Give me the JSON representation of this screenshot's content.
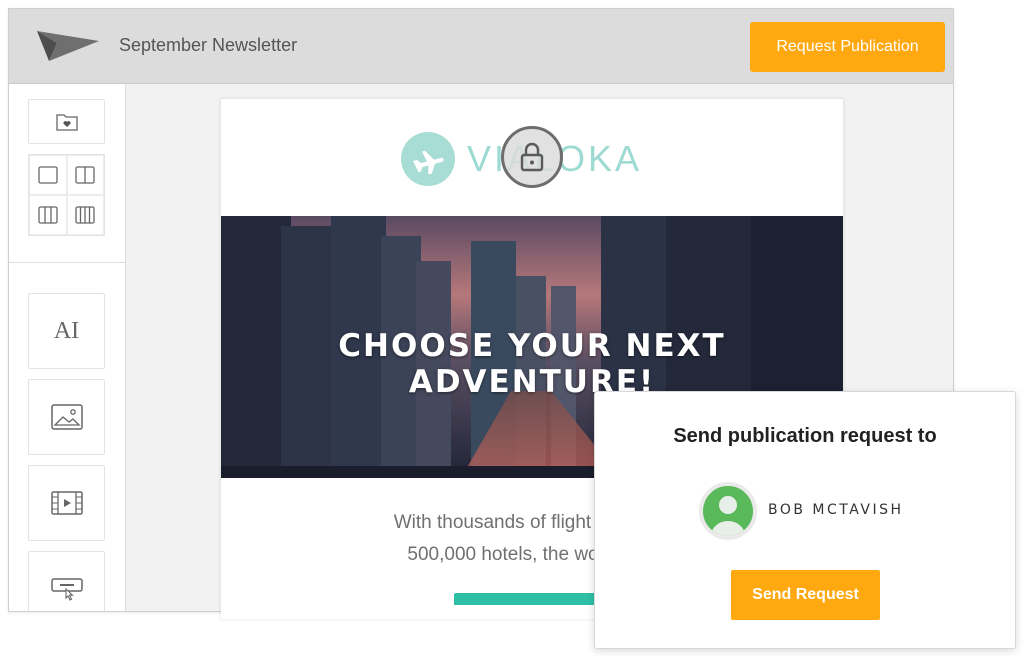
{
  "header": {
    "logo_icon": "paper-plane-logo-icon",
    "title": "September Newsletter",
    "publish_button": "Request Publication"
  },
  "sidebar": {
    "folder_icon": "favorites-folder-icon",
    "layouts": [
      "one-column-layout-icon",
      "two-column-layout-icon",
      "three-column-layout-icon",
      "four-column-layout-icon"
    ],
    "text_tool_glyph": "AI",
    "blocks": [
      "text-block-icon",
      "image-block-icon",
      "video-block-icon",
      "button-block-icon"
    ]
  },
  "newsletter": {
    "brand_name": "VIALOKA",
    "lock_icon": "lock-icon",
    "hero_headline": "CHOOSE YOUR NEXT ADVENTURE!",
    "body_line_1": "With thousands of flight combina",
    "body_line_2": "500,000 hotels, the world is a"
  },
  "popup": {
    "title": "Send publication request to",
    "recipient": "BOB MCTAVISH",
    "send_button": "Send Request"
  },
  "colors": {
    "accent": "#ffa80f",
    "brand_teal": "#9ddad2",
    "cta_green": "#2fbfa6",
    "avatar_green": "#5ab95a"
  }
}
